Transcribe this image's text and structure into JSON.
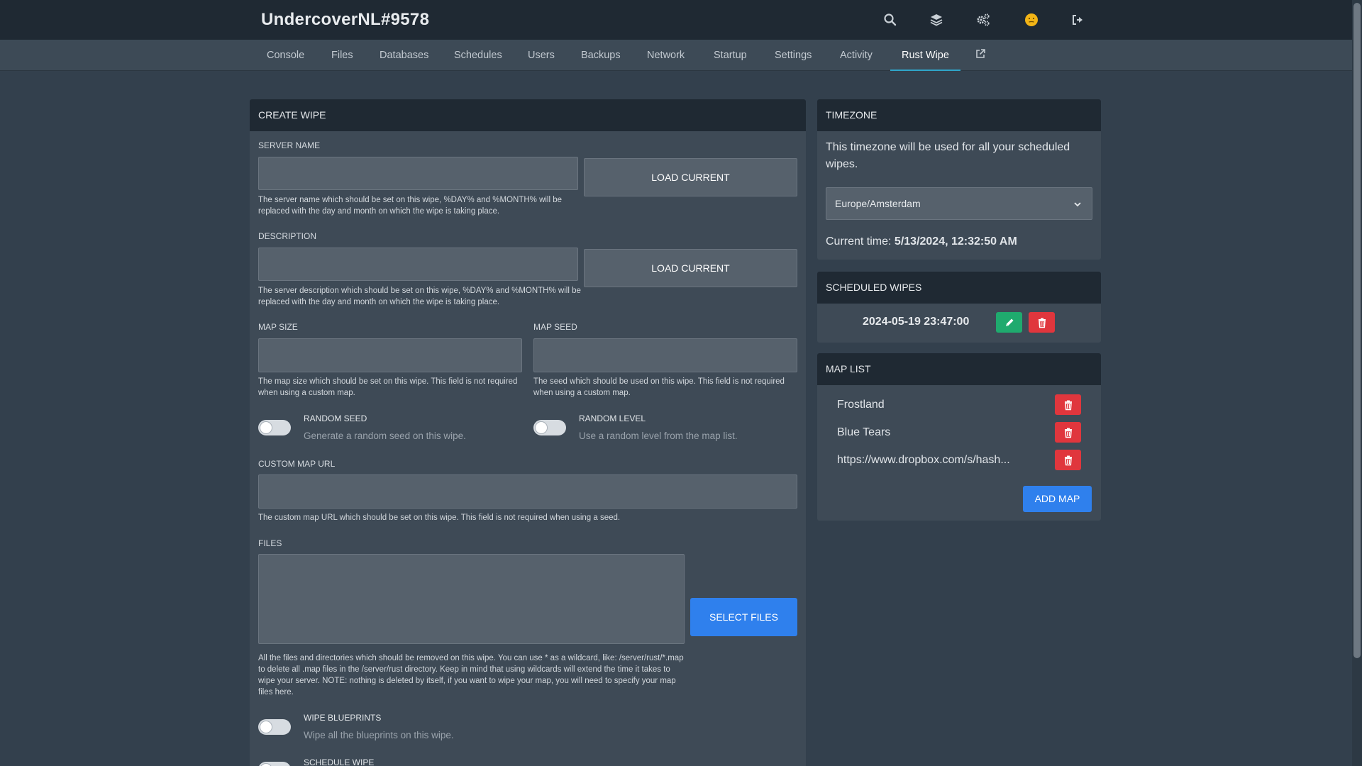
{
  "header": {
    "title": "UndercoverNL#9578",
    "icons": [
      "search-icon",
      "layers-icon",
      "cogs-icon",
      "avatar-icon",
      "logout-icon"
    ]
  },
  "nav": {
    "items": [
      "Console",
      "Files",
      "Databases",
      "Schedules",
      "Users",
      "Backups",
      "Network",
      "Startup",
      "Settings",
      "Activity",
      "Rust Wipe"
    ],
    "active": "Rust Wipe"
  },
  "create_wipe": {
    "title": "CREATE WIPE",
    "server_name": {
      "label": "SERVER NAME",
      "value": "",
      "button": "LOAD CURRENT",
      "help": "The server name which should be set on this wipe, %DAY% and %MONTH% will be replaced with the day and month on which the wipe is taking place."
    },
    "description": {
      "label": "DESCRIPTION",
      "value": "",
      "button": "LOAD CURRENT",
      "help": "The server description which should be set on this wipe, %DAY% and %MONTH% will be replaced with the day and month on which the wipe is taking place."
    },
    "map_size": {
      "label": "MAP SIZE",
      "value": "",
      "help": "The map size which should be set on this wipe. This field is not required when using a custom map."
    },
    "map_seed": {
      "label": "MAP SEED",
      "value": "",
      "help": "The seed which should be used on this wipe. This field is not required when using a custom map."
    },
    "random_seed": {
      "title": "RANDOM SEED",
      "desc": "Generate a random seed on this wipe.",
      "enabled": false
    },
    "random_level": {
      "title": "RANDOM LEVEL",
      "desc": "Use a random level from the map list.",
      "enabled": false
    },
    "custom_map_url": {
      "label": "CUSTOM MAP URL",
      "value": "",
      "help": "The custom map URL which should be set on this wipe. This field is not required when using a seed."
    },
    "files": {
      "label": "FILES",
      "value": "",
      "button": "SELECT FILES",
      "help": "All the files and directories which should be removed on this wipe. You can use * as a wildcard, like: /server/rust/*.map to delete all .map files in the /server/rust directory. Keep in mind that using wildcards will extend the time it takes to wipe your server. NOTE: nothing is deleted by itself, if you want to wipe your map, you will need to specify your map files here."
    },
    "wipe_blueprints": {
      "title": "WIPE BLUEPRINTS",
      "desc": "Wipe all the blueprints on this wipe.",
      "enabled": false
    },
    "schedule_wipe": {
      "title": "SCHEDULE WIPE"
    }
  },
  "timezone": {
    "title": "TIMEZONE",
    "text": "This timezone will be used for all your scheduled wipes.",
    "selected": "Europe/Amsterdam",
    "current_label": "Current time:",
    "current_value": "5/13/2024, 12:32:50 AM"
  },
  "scheduled_wipes": {
    "title": "SCHEDULED WIPES",
    "items": [
      {
        "datetime": "2024-05-19 23:47:00"
      }
    ]
  },
  "map_list": {
    "title": "MAP LIST",
    "items": [
      "Frostland",
      "Blue Tears",
      "https://www.dropbox.com/s/hash..."
    ],
    "add_button": "ADD MAP"
  },
  "colors": {
    "accent": "#2fa5c9",
    "primary_button": "#2f80ed",
    "danger": "#e0363d",
    "success": "#1faa6e",
    "topbar": "#1f2933",
    "page_bg": "#33404d"
  }
}
